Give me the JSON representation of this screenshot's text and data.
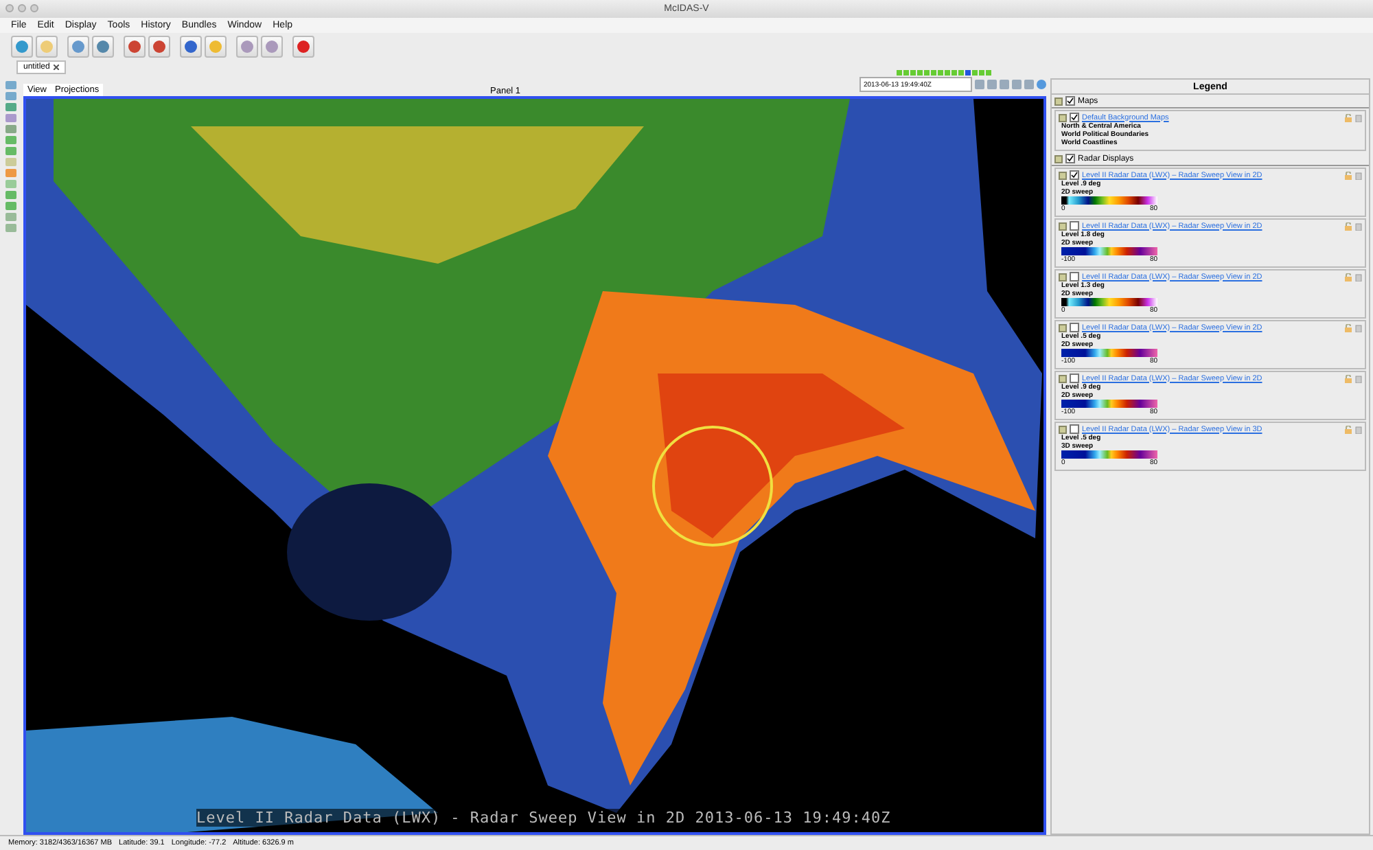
{
  "window": {
    "title": "McIDAS-V"
  },
  "menu": [
    "File",
    "Edit",
    "Display",
    "Tools",
    "History",
    "Bundles",
    "Window",
    "Help"
  ],
  "tabs": [
    {
      "label": "untitled",
      "selected": true
    }
  ],
  "view_menu": [
    "View",
    "Projections"
  ],
  "panel": {
    "title": "Panel 1",
    "overlay_text": "Level II Radar Data (LWX) - Radar Sweep View in 2D 2013-06-13 19:49:40Z"
  },
  "animation": {
    "time": "2013-06-13 19:49:40Z",
    "frames": [
      {
        "selected": false
      },
      {
        "selected": false
      },
      {
        "selected": false
      },
      {
        "selected": false
      },
      {
        "selected": false
      },
      {
        "selected": false
      },
      {
        "selected": false
      },
      {
        "selected": false
      },
      {
        "selected": false
      },
      {
        "selected": false
      },
      {
        "selected": true
      },
      {
        "selected": false
      },
      {
        "selected": false
      },
      {
        "selected": false
      }
    ]
  },
  "legend": {
    "title": "Legend",
    "groups": [
      {
        "name": "Maps",
        "visible": true,
        "layers": [
          {
            "kind": "map",
            "title": "Default Background Maps",
            "visible": true,
            "lines": [
              "North & Central America",
              "World Political Boundaries",
              "World Coastlines"
            ]
          }
        ]
      },
      {
        "name": "Radar Displays",
        "visible": true,
        "layers": [
          {
            "kind": "reflectivity",
            "title": "Level II Radar Data (LWX) – Radar Sweep View in 2D",
            "visible": true,
            "lines": [
              "Level .9 deg",
              "2D sweep"
            ],
            "min": "0",
            "max": "80"
          },
          {
            "kind": "velocity",
            "title": "Level II Radar Data (LWX) – Radar Sweep View in 2D",
            "visible": false,
            "lines": [
              "Level 1.8 deg",
              "2D sweep"
            ],
            "min": "-100",
            "max": "80"
          },
          {
            "kind": "reflectivity",
            "title": "Level II Radar Data (LWX) – Radar Sweep View in 2D",
            "visible": false,
            "lines": [
              "Level 1.3 deg",
              "2D sweep"
            ],
            "min": "0",
            "max": "80"
          },
          {
            "kind": "velocity",
            "title": "Level II Radar Data (LWX) – Radar Sweep View in 2D",
            "visible": false,
            "lines": [
              "Level .5 deg",
              "2D sweep"
            ],
            "min": "-100",
            "max": "80"
          },
          {
            "kind": "velocity",
            "title": "Level II Radar Data (LWX) – Radar Sweep View in 2D",
            "visible": false,
            "lines": [
              "Level .9 deg",
              "2D sweep"
            ],
            "min": "-100",
            "max": "80"
          },
          {
            "kind": "velocity",
            "title": "Level II Radar Data (LWX) – Radar Sweep View in 3D",
            "visible": false,
            "lines": [
              "Level .5 deg",
              "3D sweep"
            ],
            "min": "0",
            "max": "80"
          }
        ]
      }
    ]
  },
  "status_bar": [
    "Memory: 3182/4363/16367 MB",
    "Latitude:  39.1",
    "Longitude:  -77.2",
    "Altitude: 6326.9 m"
  ]
}
